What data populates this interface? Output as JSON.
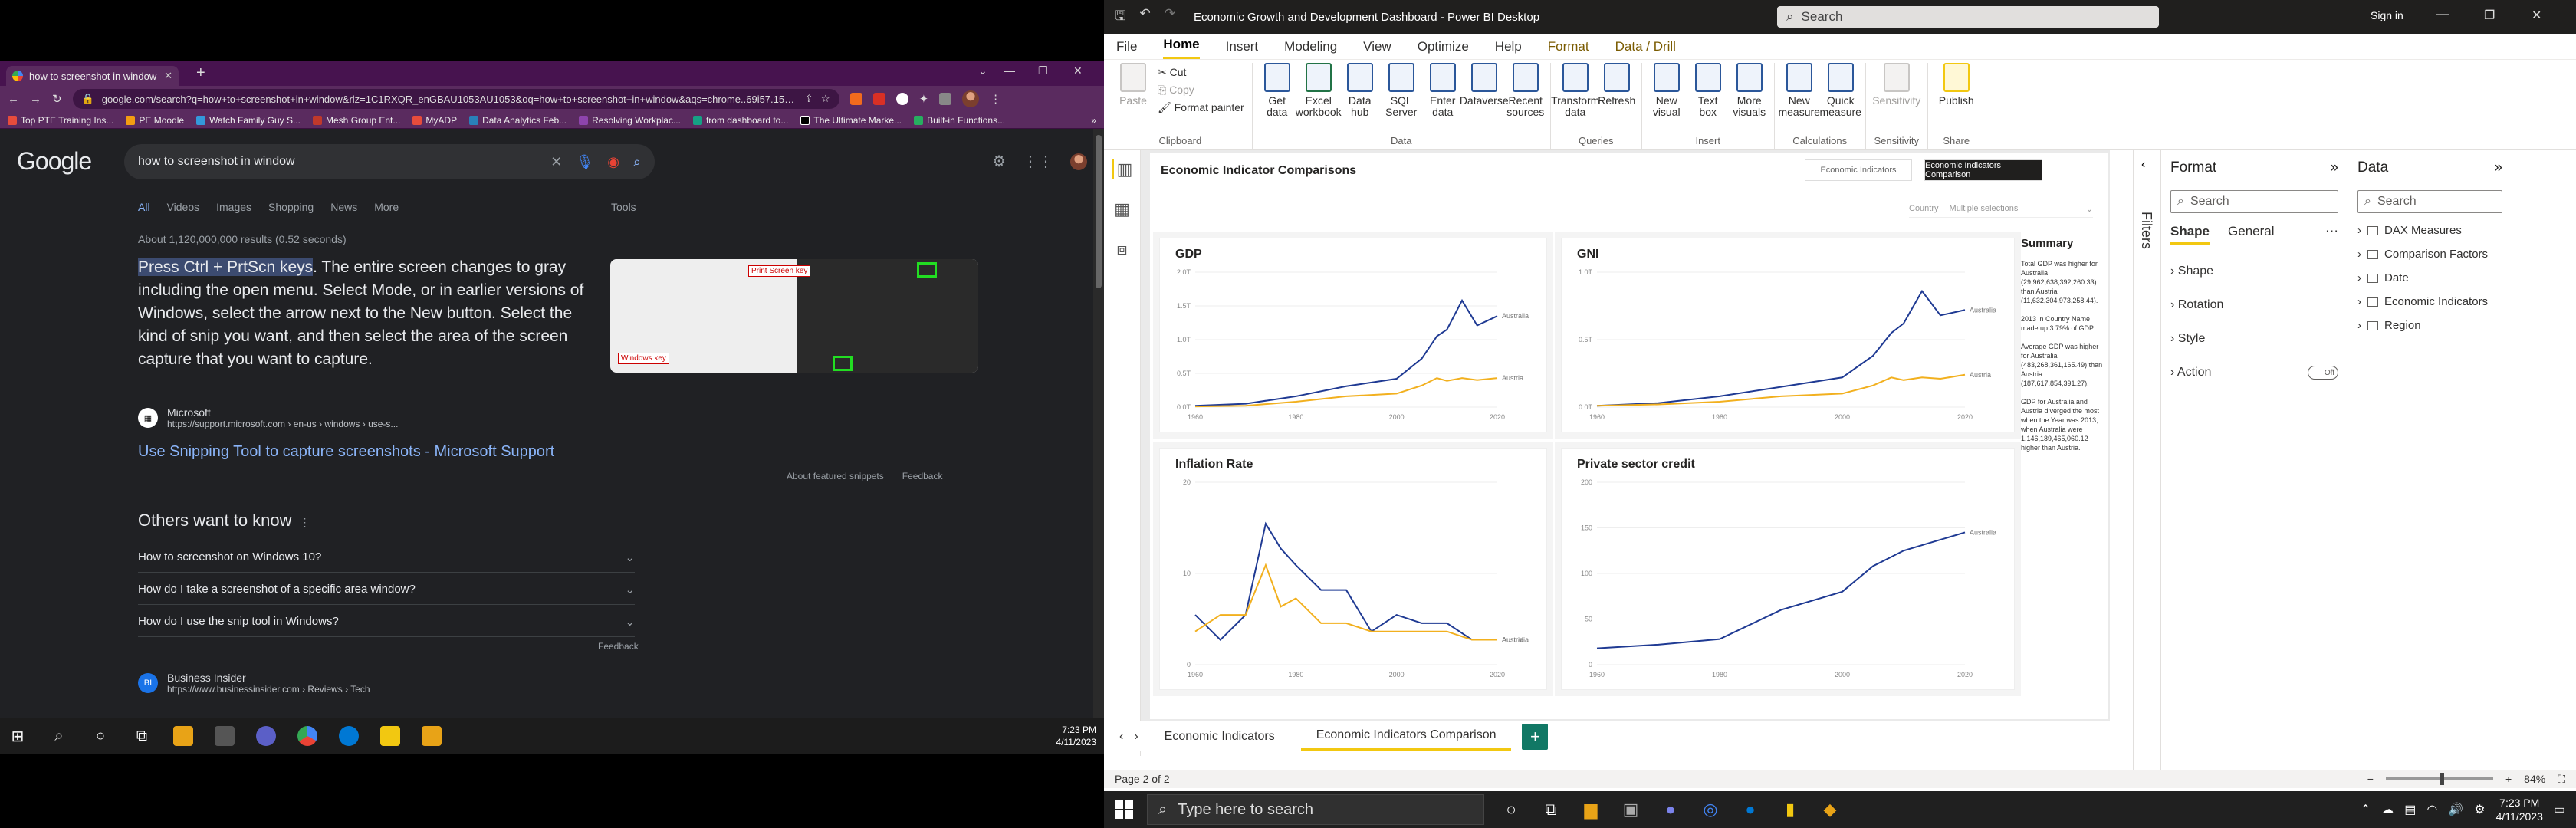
{
  "chrome": {
    "tab_title": "how to screenshot in window - G",
    "url": "google.com/search?q=how+to+screenshot+in+window&rlz=1C1RXQR_enGBAU1053AU1053&oq=how+to+screenshot+in+window&aqs=chrome..69i57.150...",
    "bookmarks": [
      "Top PTE Training Ins...",
      "PE Moodle",
      "Watch Family Guy S...",
      "Mesh Group Ent...",
      "MyADP",
      "Data Analytics Feb...",
      "Resolving Workplac...",
      "from dashboard to...",
      "The Ultimate Marke...",
      "Built-in Functions..."
    ]
  },
  "google": {
    "logo": "Google",
    "query": "how to screenshot in window",
    "tabs": [
      "All",
      "Videos",
      "Images",
      "Shopping",
      "News",
      "More"
    ],
    "tools": "Tools",
    "result_count": "About 1,120,000,000 results (0.52 seconds)",
    "snippet_highlight": "Press Ctrl + PrtScn keys",
    "snippet_rest": ". The entire screen changes to gray including the open menu. Select Mode, or in earlier versions of Windows, select the arrow next to the New button. Select the kind of snip you want, and then select the area of the screen capture that you want to capture.",
    "image_label_1": "Print Screen key",
    "image_label_2": "Windows key",
    "source_name": "Microsoft",
    "source_url": "https://support.microsoft.com › en-us › windows › use-s...",
    "result_link": "Use Snipping Tool to capture screenshots - Microsoft Support",
    "about_snippets": "About featured snippets",
    "feedback": "Feedback",
    "others_title": "Others want to know",
    "paa": [
      "How to screenshot on Windows 10?",
      "How do I take a screenshot of a specific area window?",
      "How do I use the snip tool in Windows?"
    ],
    "paa_feedback": "Feedback",
    "next_source_name": "Business Insider",
    "next_source_url": "https://www.businessinsider.com › Reviews › Tech"
  },
  "taskbar_left": {
    "time": "7:23 PM",
    "date": "4/11/2023"
  },
  "powerbi": {
    "title": "Economic Growth and Development Dashboard - Power BI Desktop",
    "search_placeholder": "Search",
    "signin": "Sign in",
    "menu": [
      "File",
      "Home",
      "Insert",
      "Modeling",
      "View",
      "Optimize",
      "Help",
      "Format",
      "Data / Drill"
    ],
    "ribbon": {
      "clipboard": {
        "paste": "Paste",
        "cut": "Cut",
        "copy": "Copy",
        "painter": "Format painter",
        "label": "Clipboard"
      },
      "data": {
        "items": [
          "Get data",
          "Excel workbook",
          "Data hub",
          "SQL Server",
          "Enter data",
          "Dataverse",
          "Recent sources"
        ],
        "label": "Data"
      },
      "queries": {
        "items": [
          "Transform data",
          "Refresh"
        ],
        "label": "Queries"
      },
      "insert": {
        "items": [
          "New visual",
          "Text box",
          "More visuals"
        ],
        "label": "Insert"
      },
      "calculations": {
        "items": [
          "New measure",
          "Quick measure"
        ],
        "label": "Calculations"
      },
      "sensitivity": {
        "items": [
          "Sensitivity"
        ],
        "label": "Sensitivity"
      },
      "share": {
        "items": [
          "Publish"
        ],
        "label": "Share"
      }
    },
    "report": {
      "title": "Economic Indicator Comparisons",
      "btn_a": "Economic Indicators",
      "btn_b": "Economic Indicators Comparison",
      "slicer_label": "Country",
      "slicer_value": "Multiple selections",
      "summary_title": "Summary",
      "summary": [
        "Total GDP was higher for Australia (29,962,638,392,260.33) than Austria (11,632,304,973,258.44).",
        "2013 in Country Name made up 3.79% of GDP.",
        "Average GDP was higher for Australia (483,268,361,165.49) than Austria (187,617,854,391.27).",
        "GDP for Australia and Austria diverged the most when the Year was 2013, when Australia were 1,146,189,465,060.12 higher than Austria."
      ]
    },
    "page_tabs": [
      "Economic Indicators",
      "Economic Indicators Comparison"
    ],
    "status": "Page 2 of 2",
    "zoom": "84%",
    "filters_label": "Filters",
    "format_pane": {
      "title": "Format",
      "search": "Search",
      "tabs": [
        "Shape",
        "General"
      ],
      "sections": [
        "Shape",
        "Rotation",
        "Style",
        "Action"
      ],
      "toggle": "Off"
    },
    "data_pane": {
      "title": "Data",
      "search": "Search",
      "items": [
        "DAX Measures",
        "Comparison Factors",
        "Date",
        "Economic Indicators",
        "Region"
      ]
    }
  },
  "taskbar_right": {
    "search": "Type here to search",
    "time": "7:23 PM",
    "date": "4/11/2023"
  },
  "colors": {
    "australia": "#1f3a93",
    "austria": "#f2b01e",
    "pbi_accent": "#f2c811",
    "chrome_frame": "#5a2b5f"
  },
  "chart_data": [
    {
      "type": "line",
      "title": "GDP",
      "x": [
        1960,
        1970,
        1980,
        1990,
        2000,
        2005,
        2008,
        2010,
        2013,
        2016,
        2020
      ],
      "xticks": [
        "1960",
        "1980",
        "2000",
        "2020"
      ],
      "yticks": [
        "0.0T",
        "0.5T",
        "1.0T",
        "1.5T",
        "2.0T"
      ],
      "ylim": [
        0,
        2.0
      ],
      "series": [
        {
          "name": "Australia",
          "values": [
            0.02,
            0.05,
            0.16,
            0.31,
            0.42,
            0.72,
            1.05,
            1.15,
            1.58,
            1.21,
            1.35
          ]
        },
        {
          "name": "Austria",
          "values": [
            0.01,
            0.02,
            0.08,
            0.16,
            0.2,
            0.32,
            0.43,
            0.39,
            0.43,
            0.4,
            0.43
          ]
        }
      ]
    },
    {
      "type": "line",
      "title": "GNI",
      "x": [
        1960,
        1970,
        1980,
        1990,
        2000,
        2005,
        2008,
        2010,
        2013,
        2016,
        2020
      ],
      "xticks": [
        "1960",
        "1980",
        "2000",
        "2020"
      ],
      "yticks": [
        "0.0T",
        "0.5T",
        "1.0T"
      ],
      "ylim": [
        0,
        1.0
      ],
      "series": [
        {
          "name": "Australia",
          "values": [
            0.01,
            0.03,
            0.08,
            0.15,
            0.22,
            0.38,
            0.55,
            0.62,
            0.86,
            0.68,
            0.72
          ]
        },
        {
          "name": "Austria",
          "values": [
            0.01,
            0.02,
            0.04,
            0.08,
            0.1,
            0.16,
            0.22,
            0.2,
            0.22,
            0.21,
            0.24
          ]
        }
      ]
    },
    {
      "type": "line",
      "title": "Inflation Rate",
      "x": [
        1960,
        1965,
        1970,
        1974,
        1977,
        1980,
        1985,
        1990,
        1995,
        2000,
        2005,
        2010,
        2015,
        2020
      ],
      "xticks": [
        "1960",
        "1980",
        "2000",
        "2020"
      ],
      "yticks": [
        "0",
        "10",
        "20"
      ],
      "ylim": [
        -2,
        20
      ],
      "series": [
        {
          "name": "Australia",
          "values": [
            4,
            1,
            4,
            15,
            12,
            10,
            7,
            7,
            2,
            4,
            3,
            3,
            1,
            1
          ]
        },
        {
          "name": "Austria",
          "values": [
            2,
            4,
            4,
            10,
            5,
            6,
            3,
            3,
            2,
            2,
            2,
            2,
            1,
            1
          ]
        }
      ]
    },
    {
      "type": "line",
      "title": "Private sector credit",
      "x": [
        1960,
        1970,
        1980,
        1990,
        2000,
        2005,
        2010,
        2015,
        2020
      ],
      "xticks": [
        "1960",
        "1980",
        "2000",
        "2020"
      ],
      "yticks": [
        "0",
        "50",
        "100",
        "150",
        "200"
      ],
      "ylim": [
        0,
        200
      ],
      "series": [
        {
          "name": "Australia",
          "values": [
            18,
            22,
            28,
            60,
            80,
            108,
            125,
            135,
            145
          ]
        },
        {
          "name": "Austria",
          "values": null
        }
      ]
    }
  ]
}
